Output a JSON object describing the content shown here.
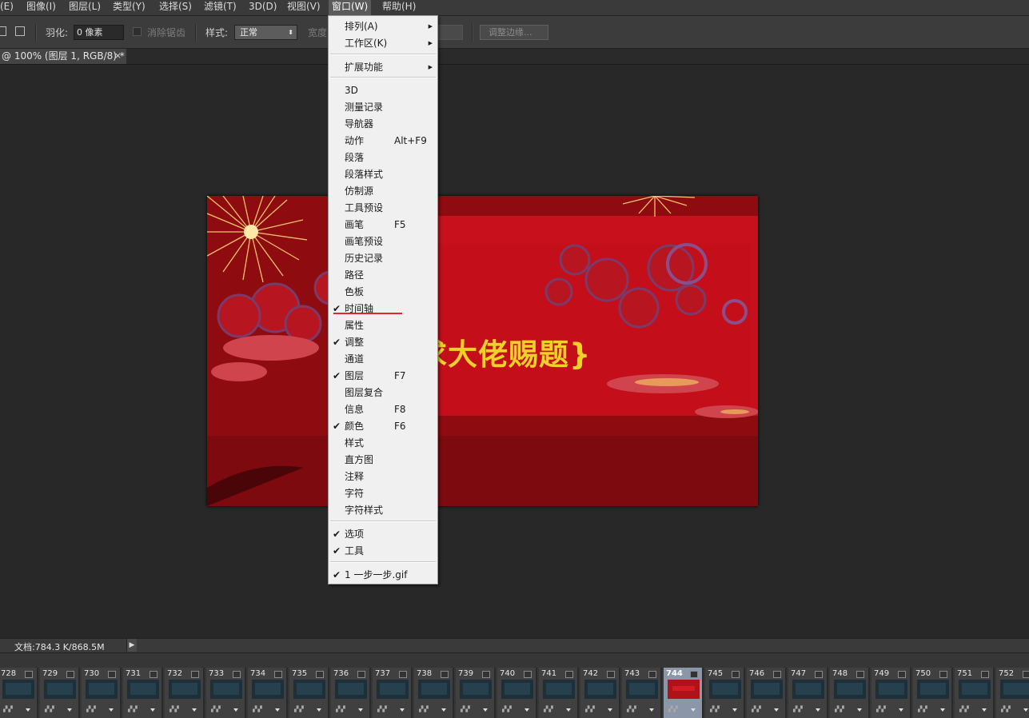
{
  "menubar": {
    "items": [
      {
        "label": "(E)"
      },
      {
        "label": "图像(I)"
      },
      {
        "label": "图层(L)"
      },
      {
        "label": "类型(Y)"
      },
      {
        "label": "选择(S)"
      },
      {
        "label": "滤镜(T)"
      },
      {
        "label": "3D(D)"
      },
      {
        "label": "视图(V)"
      },
      {
        "label": "窗口(W)"
      },
      {
        "label": "帮助(H)"
      }
    ]
  },
  "options": {
    "feather_label": "羽化:",
    "feather_value": "0 像素",
    "antialias_label": "消除锯齿",
    "style_label": "样式:",
    "style_value": "正常",
    "width_label": "宽度",
    "refine_edge_button": "调整边缘..."
  },
  "tab": {
    "title": "@ 100% (图层 1, RGB/8) *",
    "close": "×"
  },
  "canvas": {
    "title_text": "求大佬赐题}"
  },
  "status": {
    "doc_info": "文档:784.3 K/868.5M"
  },
  "window_menu": {
    "items": [
      {
        "label": "排列(A)",
        "submenu": true
      },
      {
        "label": "工作区(K)",
        "submenu": true
      },
      {
        "label": "扩展功能",
        "submenu": true
      },
      {
        "label": "3D"
      },
      {
        "label": "测量记录"
      },
      {
        "label": "导航器"
      },
      {
        "label": "动作",
        "shortcut": "Alt+F9"
      },
      {
        "label": "段落"
      },
      {
        "label": "段落样式"
      },
      {
        "label": "仿制源"
      },
      {
        "label": "工具预设"
      },
      {
        "label": "画笔",
        "shortcut": "F5"
      },
      {
        "label": "画笔预设"
      },
      {
        "label": "历史记录"
      },
      {
        "label": "路径"
      },
      {
        "label": "色板"
      },
      {
        "label": "时间轴",
        "checked": true
      },
      {
        "label": "属性"
      },
      {
        "label": "调整",
        "checked": true
      },
      {
        "label": "通道"
      },
      {
        "label": "图层",
        "shortcut": "F7",
        "checked": true
      },
      {
        "label": "图层复合"
      },
      {
        "label": "信息",
        "shortcut": "F8"
      },
      {
        "label": "颜色",
        "shortcut": "F6",
        "checked": true
      },
      {
        "label": "样式"
      },
      {
        "label": "直方图"
      },
      {
        "label": "注释"
      },
      {
        "label": "字符"
      },
      {
        "label": "字符样式"
      },
      {
        "label": "选项",
        "checked": true
      },
      {
        "label": "工具",
        "checked": true
      },
      {
        "label": "1 一步一步.gif",
        "checked": true
      }
    ],
    "check_glyph": "✔",
    "submenu_glyph": "▶"
  },
  "timeline": {
    "frames": [
      "728",
      "729",
      "730",
      "731",
      "732",
      "733",
      "734",
      "735",
      "736",
      "737",
      "738",
      "739",
      "740",
      "741",
      "742",
      "743",
      "744",
      "745",
      "746",
      "747",
      "748",
      "749",
      "750",
      "751",
      "752"
    ],
    "selected": "744"
  },
  "colors": {
    "menu_bg": "#3a3a3a",
    "workspace_bg": "#282828",
    "canvas_red": "#8e0b10",
    "title_yellow": "#f0d12a",
    "dropdown_bg": "#f0f0f0",
    "annotation_red": "#e0262f"
  }
}
